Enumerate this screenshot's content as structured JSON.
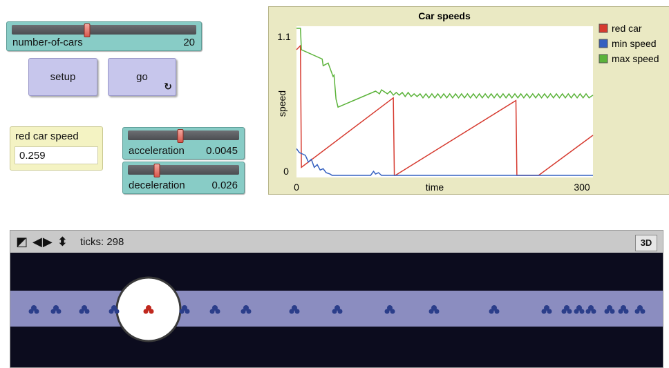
{
  "sliders": {
    "number_of_cars": {
      "label": "number-of-cars",
      "value": "20",
      "fraction": 0.41
    },
    "acceleration": {
      "label": "acceleration",
      "value": "0.0045",
      "fraction": 0.47
    },
    "deceleration": {
      "label": "deceleration",
      "value": "0.026",
      "fraction": 0.26
    }
  },
  "buttons": {
    "setup": "setup",
    "go": "go",
    "go_forever_icon": "forever-loop-icon"
  },
  "monitor": {
    "label": "red car speed",
    "value": "0.259"
  },
  "view": {
    "ticks_label": "ticks: 298",
    "icons": [
      "shape-editor-icon",
      "horizontal-arrows-icon",
      "vertical-arrows-icon"
    ],
    "button_3d": "3D",
    "road_color": "#8b8dc0",
    "background_color": "#0c0c1e",
    "car_color": "#2b3e8a",
    "red_car_color": "#c0281e"
  },
  "chart_data": {
    "type": "line",
    "title": "Car speeds",
    "xlabel": "time",
    "ylabel": "speed",
    "xlim": [
      0,
      300
    ],
    "ylim": [
      0,
      1.1
    ],
    "x_tick_labels": [
      "0",
      "300"
    ],
    "y_tick_labels": [
      "0",
      "1.1"
    ],
    "legend_position": "right",
    "series": [
      {
        "name": "red car",
        "color": "#d63a2f",
        "points": [
          [
            0,
            0.94
          ],
          [
            4,
            0.97
          ],
          [
            5,
            0.06
          ],
          [
            98,
            0.58
          ],
          [
            99,
            0
          ],
          [
            100,
            0
          ],
          [
            222,
            0.56
          ],
          [
            223,
            0
          ],
          [
            245,
            0
          ],
          [
            300,
            0.3
          ]
        ]
      },
      {
        "name": "min speed",
        "color": "#3460c0",
        "points": [
          [
            0,
            0.2
          ],
          [
            3,
            0.17
          ],
          [
            6,
            0.16
          ],
          [
            9,
            0.15
          ],
          [
            12,
            0.1
          ],
          [
            15,
            0.12
          ],
          [
            18,
            0.06
          ],
          [
            21,
            0.08
          ],
          [
            24,
            0.04
          ],
          [
            27,
            0.05
          ],
          [
            30,
            0.02
          ],
          [
            34,
            0.01
          ],
          [
            36,
            0
          ],
          [
            75,
            0
          ],
          [
            78,
            0.03
          ],
          [
            80,
            0.01
          ],
          [
            83,
            0.02
          ],
          [
            86,
            0
          ],
          [
            300,
            0
          ]
        ]
      },
      {
        "name": "max speed",
        "color": "#5bb33a",
        "points": [
          [
            0,
            1.1
          ],
          [
            4,
            1.1
          ],
          [
            5,
            0.94
          ],
          [
            26,
            0.87
          ],
          [
            27,
            0.82
          ],
          [
            32,
            0.84
          ],
          [
            37,
            0.74
          ],
          [
            38,
            0.75
          ],
          [
            40,
            0.57
          ],
          [
            42,
            0.51
          ],
          [
            80,
            0.63
          ],
          [
            84,
            0.61
          ],
          [
            86,
            0.64
          ],
          [
            92,
            0.61
          ],
          [
            95,
            0.63
          ],
          [
            98,
            0.6
          ],
          [
            101,
            0.62
          ],
          [
            104,
            0.6
          ],
          [
            107,
            0.62
          ],
          [
            110,
            0.59
          ],
          [
            113,
            0.62
          ],
          [
            116,
            0.59
          ],
          [
            119,
            0.61
          ],
          [
            122,
            0.59
          ],
          [
            125,
            0.61
          ],
          [
            128,
            0.58
          ],
          [
            131,
            0.61
          ],
          [
            134,
            0.58
          ],
          [
            137,
            0.61
          ],
          [
            140,
            0.58
          ],
          [
            143,
            0.61
          ],
          [
            146,
            0.58
          ],
          [
            149,
            0.61
          ],
          [
            152,
            0.58
          ],
          [
            155,
            0.61
          ],
          [
            158,
            0.58
          ],
          [
            161,
            0.61
          ],
          [
            164,
            0.58
          ],
          [
            167,
            0.61
          ],
          [
            170,
            0.58
          ],
          [
            173,
            0.61
          ],
          [
            176,
            0.58
          ],
          [
            179,
            0.61
          ],
          [
            182,
            0.58
          ],
          [
            185,
            0.61
          ],
          [
            188,
            0.58
          ],
          [
            191,
            0.61
          ],
          [
            194,
            0.58
          ],
          [
            197,
            0.61
          ],
          [
            200,
            0.58
          ],
          [
            203,
            0.61
          ],
          [
            206,
            0.58
          ],
          [
            209,
            0.61
          ],
          [
            212,
            0.58
          ],
          [
            215,
            0.61
          ],
          [
            218,
            0.58
          ],
          [
            221,
            0.61
          ],
          [
            224,
            0.58
          ],
          [
            227,
            0.61
          ],
          [
            230,
            0.58
          ],
          [
            233,
            0.61
          ],
          [
            236,
            0.58
          ],
          [
            239,
            0.61
          ],
          [
            242,
            0.58
          ],
          [
            245,
            0.61
          ],
          [
            248,
            0.58
          ],
          [
            251,
            0.61
          ],
          [
            254,
            0.58
          ],
          [
            257,
            0.61
          ],
          [
            260,
            0.58
          ],
          [
            263,
            0.61
          ],
          [
            266,
            0.58
          ],
          [
            269,
            0.61
          ],
          [
            272,
            0.58
          ],
          [
            275,
            0.61
          ],
          [
            278,
            0.58
          ],
          [
            281,
            0.61
          ],
          [
            284,
            0.58
          ],
          [
            287,
            0.61
          ],
          [
            290,
            0.58
          ],
          [
            293,
            0.61
          ],
          [
            296,
            0.58
          ],
          [
            300,
            0.6
          ]
        ]
      }
    ]
  }
}
